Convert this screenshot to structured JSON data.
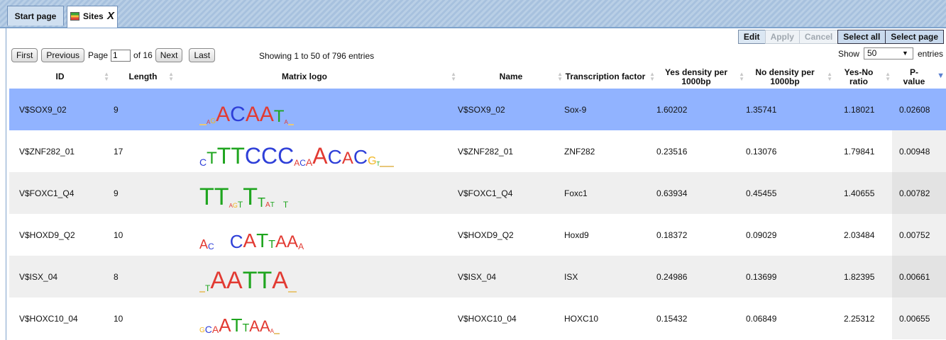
{
  "tabs": [
    {
      "label": "Start page"
    },
    {
      "label": "Sites",
      "close": "X"
    }
  ],
  "actions": {
    "edit": "Edit",
    "apply": "Apply",
    "cancel": "Cancel",
    "select_all": "Select all",
    "select_page": "Select page"
  },
  "pager": {
    "first": "First",
    "previous": "Previous",
    "page_label": "Page",
    "page_value": "1",
    "of_total": "of 16",
    "next": "Next",
    "last": "Last"
  },
  "showing": "Showing 1 to 50 of 796 entries",
  "show_entries": {
    "show": "Show",
    "value": "50",
    "entries": "entries"
  },
  "columns": {
    "id": "ID",
    "length": "Length",
    "matrix_logo": "Matrix logo",
    "name": "Name",
    "tf": "Transcription factor",
    "yes_density": "Yes density per 1000bp",
    "no_density": "No density per 1000bp",
    "ratio": "Yes-No ratio",
    "pvalue": "P-value"
  },
  "rows": [
    {
      "id": "V$SOX9_02",
      "length": "9",
      "name": "V$SOX9_02",
      "tf": "Sox-9",
      "yes": "1.60202",
      "no": "1.35741",
      "ratio": "1.18021",
      "p": "0.02608"
    },
    {
      "id": "V$ZNF282_01",
      "length": "17",
      "name": "V$ZNF282_01",
      "tf": "ZNF282",
      "yes": "0.23516",
      "no": "0.13076",
      "ratio": "1.79841",
      "p": "0.00948"
    },
    {
      "id": "V$FOXC1_Q4",
      "length": "9",
      "name": "V$FOXC1_Q4",
      "tf": "Foxc1",
      "yes": "0.63934",
      "no": "0.45455",
      "ratio": "1.40655",
      "p": "0.00782"
    },
    {
      "id": "V$HOXD9_Q2",
      "length": "10",
      "name": "V$HOXD9_Q2",
      "tf": "Hoxd9",
      "yes": "0.18372",
      "no": "0.09029",
      "ratio": "2.03484",
      "p": "0.00752"
    },
    {
      "id": "V$ISX_04",
      "length": "8",
      "name": "V$ISX_04",
      "tf": "ISX",
      "yes": "0.24986",
      "no": "0.13699",
      "ratio": "1.82395",
      "p": "0.00661"
    },
    {
      "id": "V$HOXC10_04",
      "length": "10",
      "name": "V$HOXC10_04",
      "tf": "HOXC10",
      "yes": "0.15432",
      "no": "0.06849",
      "ratio": "2.25312",
      "p": "0.00655"
    }
  ]
}
